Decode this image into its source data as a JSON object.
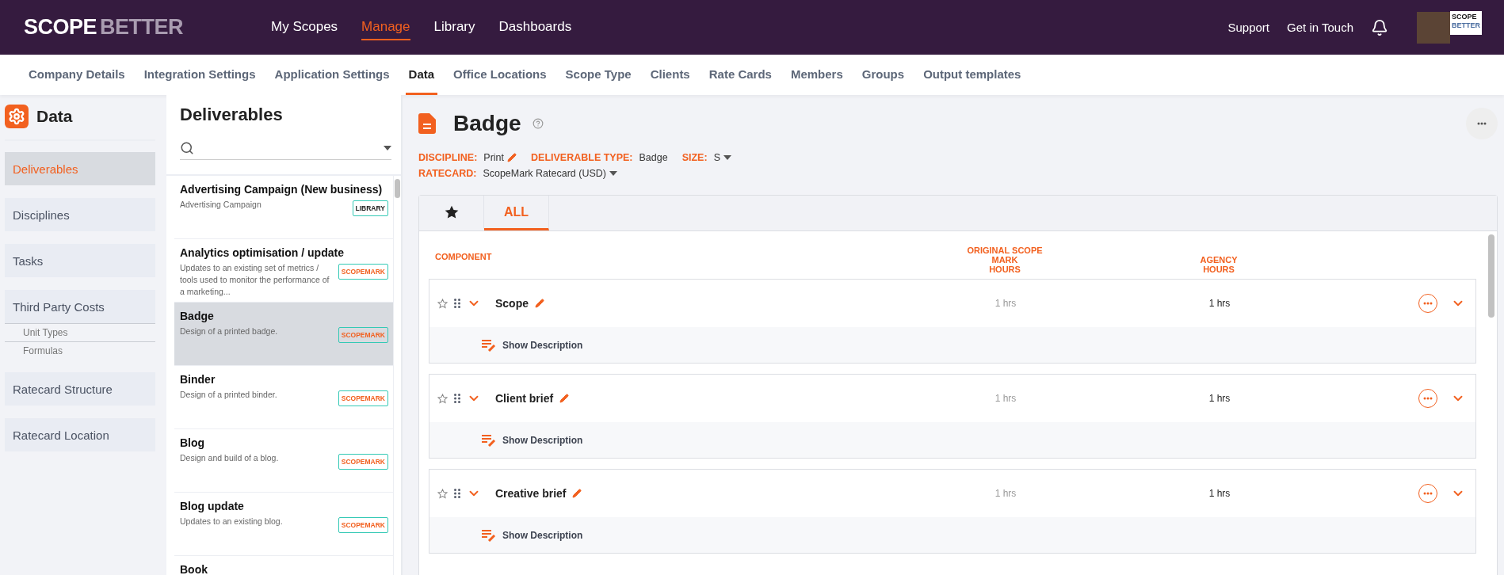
{
  "header": {
    "logo": {
      "first": "SCOPE",
      "second": "BETTER"
    },
    "nav": [
      {
        "label": "My Scopes",
        "selected": false
      },
      {
        "label": "Manage",
        "selected": true
      },
      {
        "label": "Library",
        "selected": false
      },
      {
        "label": "Dashboards",
        "selected": false
      }
    ],
    "links": [
      "Support",
      "Get in Touch"
    ],
    "account_logo": {
      "first": "SCOPE",
      "second": "BETTER"
    }
  },
  "subnav": [
    {
      "label": "Company Details",
      "selected": false
    },
    {
      "label": "Integration Settings",
      "selected": false
    },
    {
      "label": "Application Settings",
      "selected": false
    },
    {
      "label": "Data",
      "selected": true
    },
    {
      "label": "Office Locations",
      "selected": false
    },
    {
      "label": "Scope Type",
      "selected": false
    },
    {
      "label": "Clients",
      "selected": false
    },
    {
      "label": "Rate Cards",
      "selected": false
    },
    {
      "label": "Members",
      "selected": false
    },
    {
      "label": "Groups",
      "selected": false
    },
    {
      "label": "Output templates",
      "selected": false
    }
  ],
  "sidebar": {
    "title": "Data",
    "items": [
      {
        "label": "Deliverables",
        "selected": true
      },
      {
        "label": "Disciplines",
        "selected": false
      },
      {
        "label": "Tasks",
        "selected": false
      },
      {
        "label": "Third Party Costs",
        "selected": false,
        "children": [
          {
            "label": "Unit Types",
            "selected": false
          },
          {
            "label": "Formulas",
            "selected": false
          }
        ]
      },
      {
        "label": "Ratecard Structure",
        "selected": false
      },
      {
        "label": "Ratecard Location",
        "selected": false
      }
    ]
  },
  "list": {
    "title": "Deliverables",
    "items": [
      {
        "title": "Advertising Campaign (New business)",
        "description": "Advertising Campaign",
        "tag": {
          "label": "LIBRARY",
          "kind": "library"
        },
        "selected": false
      },
      {
        "title": "Analytics optimisation / update",
        "description": "Updates to an existing set of metrics / tools used to monitor the performance of a marketing...",
        "tag": {
          "label": "SCOPEMARK",
          "kind": "scopemark"
        },
        "selected": false
      },
      {
        "title": "Badge",
        "description": "Design of a printed badge.",
        "tag": {
          "label": "SCOPEMARK",
          "kind": "scopemark"
        },
        "selected": true
      },
      {
        "title": "Binder",
        "description": "Design of a printed binder.",
        "tag": {
          "label": "SCOPEMARK",
          "kind": "scopemark"
        },
        "selected": false
      },
      {
        "title": "Blog",
        "description": "Design and build of a blog.",
        "tag": {
          "label": "SCOPEMARK",
          "kind": "scopemark"
        },
        "selected": false
      },
      {
        "title": "Blog update",
        "description": "Updates to an existing blog.",
        "tag": {
          "label": "SCOPEMARK",
          "kind": "scopemark"
        },
        "selected": false
      },
      {
        "title": "Book",
        "selected": false
      }
    ]
  },
  "detail": {
    "title": "Badge",
    "meta_lines": [
      [
        {
          "label": "DISCIPLINE:",
          "value": "Print",
          "kind": "edit"
        },
        {
          "label": "DELIVERABLE TYPE:",
          "value": "Badge",
          "kind": "plain"
        },
        {
          "label": "SIZE:",
          "value": "S",
          "kind": "dropdown"
        }
      ],
      [
        {
          "label": "RATECARD:",
          "value": "ScopeMark Ratecard (USD)",
          "kind": "dropdown"
        }
      ]
    ],
    "tabs": [
      {
        "kind": "star",
        "selected": false
      },
      {
        "kind": "text",
        "label": "ALL",
        "selected": true
      }
    ],
    "columns": [
      "COMPONENT",
      "ORIGINAL SCOPE\nMARK\nHOURS",
      "AGENCY\nHOURS"
    ],
    "components": [
      {
        "name": "Scope",
        "original": "1 hrs",
        "agency": "1 hrs",
        "action": "Show Description"
      },
      {
        "name": "Client brief",
        "original": "1 hrs",
        "agency": "1 hrs",
        "action": "Show Description"
      },
      {
        "name": "Creative brief",
        "original": "1 hrs",
        "agency": "1 hrs",
        "action": "Show Description"
      }
    ]
  }
}
